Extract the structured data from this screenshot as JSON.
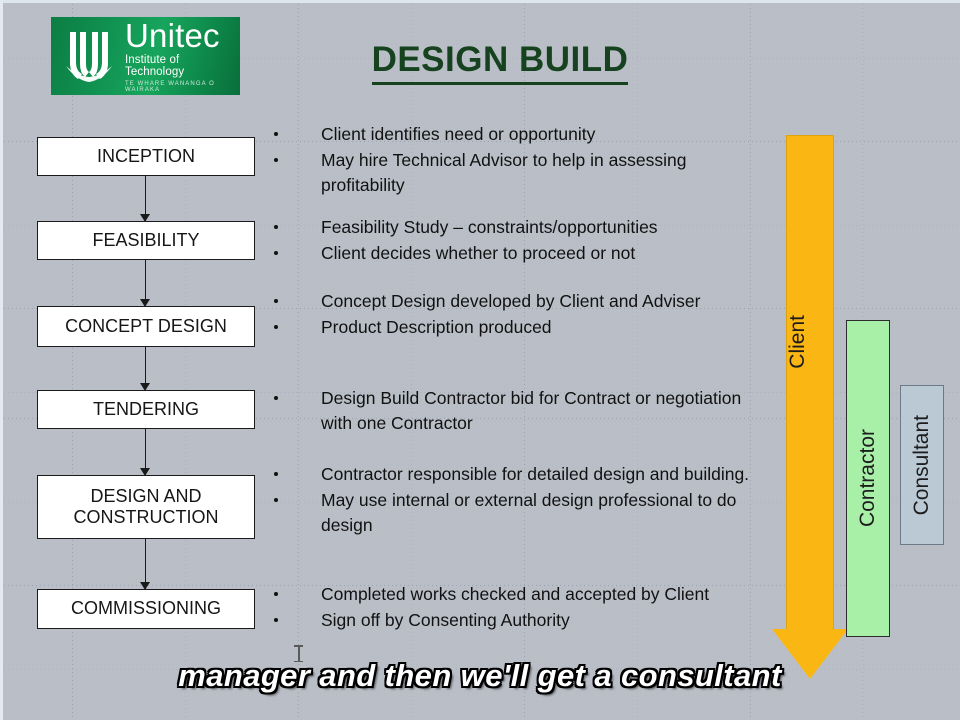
{
  "slide": {
    "title": "DESIGN BUILD"
  },
  "logo": {
    "name": "Unitec",
    "subtitle": "Institute of Technology",
    "maori": "TE WHARE WANANGA O WAIRAKA",
    "mark_icon": "unitec-book-u-icon",
    "brand_color": "#109150"
  },
  "flowchart": {
    "stages": [
      {
        "label": "INCEPTION"
      },
      {
        "label": "FEASIBILITY"
      },
      {
        "label": "CONCEPT DESIGN"
      },
      {
        "label": "TENDERING"
      },
      {
        "label": "DESIGN AND CONSTRUCTION"
      },
      {
        "label": "COMMISSIONING"
      }
    ]
  },
  "bullet_groups": [
    {
      "stage": "INCEPTION",
      "items": [
        "Client identifies need or opportunity",
        "May hire Technical Advisor to help in assessing profitability"
      ]
    },
    {
      "stage": "FEASIBILITY",
      "items": [
        "Feasibility Study – constraints/opportunities",
        "Client decides whether to proceed or not"
      ]
    },
    {
      "stage": "CONCEPT DESIGN",
      "items": [
        "Concept Design developed by Client and Adviser",
        "Product Description produced"
      ]
    },
    {
      "stage": "TENDERING",
      "items": [
        "Design Build Contractor bid for Contract or negotiation with one Contractor"
      ]
    },
    {
      "stage": "DESIGN AND CONSTRUCTION",
      "items": [
        "Contractor responsible for detailed design and building.",
        "May use internal or external design professional to do design"
      ]
    },
    {
      "stage": "COMMISSIONING",
      "items": [
        "Completed works checked and accepted by Client",
        "Sign off by Consenting Authority"
      ]
    }
  ],
  "roles": [
    {
      "label": "Client",
      "color": "#fab714",
      "shape": "down-arrow"
    },
    {
      "label": "Contractor",
      "color": "#a8f0a8",
      "shape": "bar"
    },
    {
      "label": "Consultant",
      "color": "#bac9d4",
      "shape": "bar"
    }
  ],
  "caption": {
    "text": "manager and then we'll get a consultant"
  }
}
